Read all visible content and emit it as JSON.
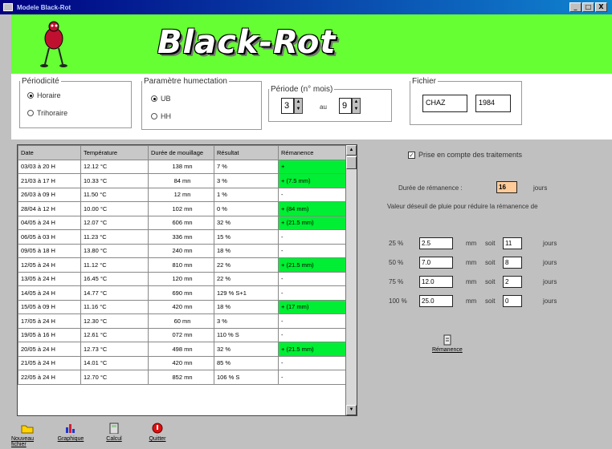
{
  "window": {
    "title": "Modele Black-Rot",
    "buttons": [
      "_",
      "□",
      "X"
    ]
  },
  "header": {
    "logo_text": "Black-Rot",
    "colors": {
      "header": "#66ff33",
      "remanence": "#00ee33"
    }
  },
  "periodicite": {
    "legend": "Périodicité",
    "options": [
      "Horaire",
      "Trihoraire"
    ],
    "selected": "Horaire"
  },
  "humectation": {
    "legend": "Paramètre humectation",
    "options": [
      "UB",
      "HH"
    ],
    "selected": "UB"
  },
  "periode": {
    "legend": "Période (n° mois)",
    "from": "3",
    "sep": "au",
    "to": "9"
  },
  "fichier": {
    "legend": "Fichier",
    "name": "CHAZ",
    "year": "1984"
  },
  "table": {
    "headers": [
      "Date",
      "Température",
      "Durée de mouillage",
      "Résultat",
      "Rémanence"
    ],
    "rows": [
      [
        "03/03 à 20 H",
        "12.12 °C",
        "138 mn",
        "7 %",
        "+",
        true
      ],
      [
        "21/03 à 17 H",
        "10.33 °C",
        "84 mn",
        "3 %",
        "+ (7.5 mm)",
        true
      ],
      [
        "26/03 à 09 H",
        "11.50 °C",
        "12 mn",
        "1 %",
        "-",
        false
      ],
      [
        "28/04 à 12 H",
        "10.00 °C",
        "102 mn",
        "0 %",
        "+ (84 mm)",
        true
      ],
      [
        "04/05 à 24 H",
        "12.07 °C",
        "606 mn",
        "32 %",
        "+ (21.5 mm)",
        true
      ],
      [
        "06/05 à 03 H",
        "11.23 °C",
        "336 mn",
        "15 %",
        "-",
        false
      ],
      [
        "09/05 à 18 H",
        "13.80 °C",
        "240 mn",
        "18 %",
        "-",
        false
      ],
      [
        "12/05 à 24 H",
        "11.12 °C",
        "810 mn",
        "22 %",
        "+ (21.5 mm)",
        true
      ],
      [
        "13/05 à 24 H",
        "16.45 °C",
        "120 mn",
        "22 %",
        "-",
        false
      ],
      [
        "14/05 à 24 H",
        "14.77 °C",
        "690 mn",
        "129 % S+1",
        "-",
        false
      ],
      [
        "15/05 à 09 H",
        "11.16 °C",
        "420 mn",
        "18 %",
        "+ (17 mm)",
        true
      ],
      [
        "17/05 à 24 H",
        "12.30 °C",
        "60 mn",
        "3 %",
        "-",
        false
      ],
      [
        "19/05 à 16 H",
        "12.61 °C",
        "072 mn",
        "110 % S",
        "-",
        false
      ],
      [
        "20/05 à 24 H",
        "12.73 °C",
        "498 mn",
        "32 %",
        "+ (21.5 mm)",
        true
      ],
      [
        "21/05 à 24 H",
        "14.01 °C",
        "420 mn",
        "85 %",
        "-",
        false
      ],
      [
        "22/05 à 24 H",
        "12.70 °C",
        "852 mn",
        "106 % S",
        "-",
        false
      ]
    ]
  },
  "right": {
    "checkbox_label": "Prise en compte des traitements",
    "duree_label": "Durée de rémanence :",
    "duree_value": "16",
    "duree_unit": "jours",
    "seuil_text": "Valeur déseuil de pluie pour réduire la rémanence de",
    "reductions": [
      {
        "pct": "25 %",
        "val": "2.5",
        "mm": "mm",
        "soit": "soit",
        "days": "11",
        "unit": "jours"
      },
      {
        "pct": "50 %",
        "val": "7.0",
        "mm": "mm",
        "soit": "soit",
        "days": "8",
        "unit": "jours"
      },
      {
        "pct": "75 %",
        "val": "12.0",
        "mm": "mm",
        "soit": "soit",
        "days": "2",
        "unit": "jours"
      },
      {
        "pct": "100 %",
        "val": "25.0",
        "mm": "mm",
        "soit": "soit",
        "days": "0",
        "unit": "jours"
      }
    ],
    "remanence_button": "Rémanence"
  },
  "toolbar": [
    {
      "label": "Nouveau fichier",
      "icon": "folder-icon"
    },
    {
      "label": "Graphique",
      "icon": "chart-icon"
    },
    {
      "label": "Calcul",
      "icon": "calculator-icon"
    },
    {
      "label": "Quitter",
      "icon": "exit-icon"
    }
  ]
}
